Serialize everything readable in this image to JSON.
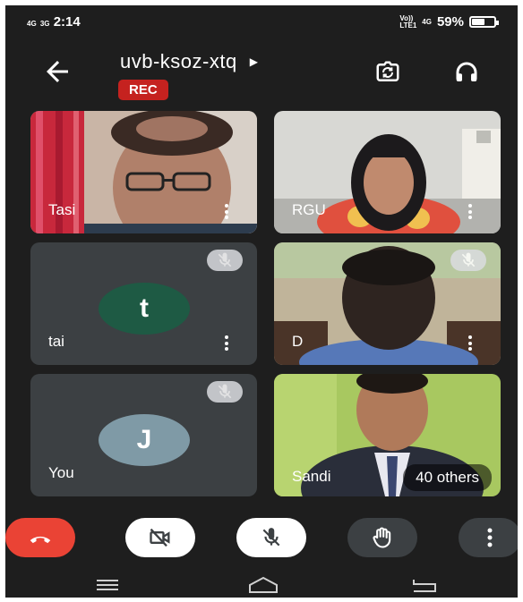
{
  "status_bar": {
    "network_1": "4G",
    "network_2": "3G",
    "time": "2:14",
    "volte": "Vo))",
    "lte": "LTE1",
    "network_3": "4G",
    "battery": "59%",
    "battery_level": 0.59
  },
  "meeting": {
    "code": "uvb-ksoz-xtq",
    "rec_label": "REC"
  },
  "participants": [
    {
      "name": "Tasi",
      "muted": false
    },
    {
      "name": "RGU",
      "muted": false
    },
    {
      "name": "tai",
      "initial": "t",
      "muted": true,
      "avatar_color": "#1e5a44"
    },
    {
      "name": "D",
      "muted": true
    },
    {
      "name": "You",
      "initial": "J",
      "muted": true,
      "avatar_color": "#7f9aa6"
    },
    {
      "name": "Sandi",
      "muted": false
    }
  ],
  "others_label": "40 others",
  "colors": {
    "end_call": "#ea4335",
    "rec": "#c5221f",
    "control_bg": "#ffffff",
    "control_dark": "#3c4043"
  },
  "icons": [
    "back-arrow-icon",
    "switch-camera-icon",
    "headphones-icon",
    "mic-off-icon",
    "more-vert-icon",
    "end-call-icon",
    "camera-off-icon",
    "raise-hand-icon",
    "nav-menu-icon",
    "nav-home-icon",
    "nav-back-icon"
  ]
}
